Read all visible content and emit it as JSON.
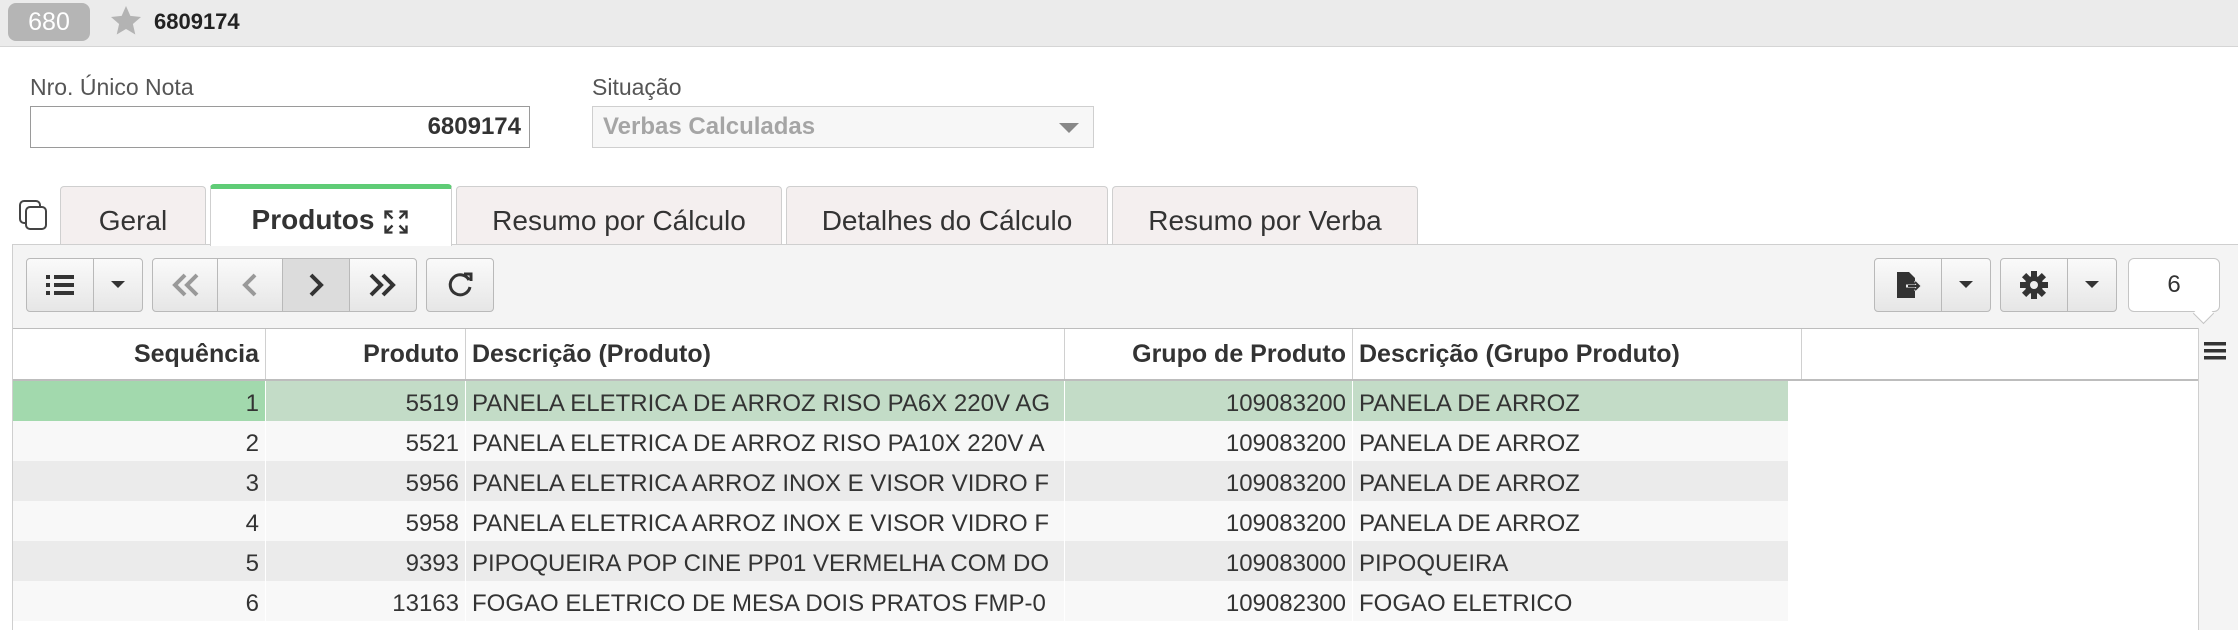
{
  "header": {
    "record_badge": "680",
    "record_id": "6809174"
  },
  "form": {
    "nro_label": "Nro. Único Nota",
    "nro_value": "6809174",
    "situacao_label": "Situação",
    "situacao_value": "Verbas Calculadas"
  },
  "tabs": [
    {
      "label": "Geral"
    },
    {
      "label": "Produtos"
    },
    {
      "label": "Resumo por Cálculo"
    },
    {
      "label": "Detalhes do Cálculo"
    },
    {
      "label": "Resumo por Verba"
    }
  ],
  "toolbar": {
    "record_count": "6"
  },
  "table": {
    "columns": [
      "Sequência",
      "Produto",
      "Descrição (Produto)",
      "Grupo de Produto",
      "Descrição (Grupo Produto)"
    ],
    "rows": [
      {
        "seq": "1",
        "produto": "5519",
        "descricao": "PANELA ELETRICA DE ARROZ RISO PA6X 220V AG",
        "grupo": "109083200",
        "grupo_desc": "PANELA DE ARROZ"
      },
      {
        "seq": "2",
        "produto": "5521",
        "descricao": "PANELA ELETRICA DE ARROZ RISO PA10X 220V A",
        "grupo": "109083200",
        "grupo_desc": "PANELA DE ARROZ"
      },
      {
        "seq": "3",
        "produto": "5956",
        "descricao": "PANELA ELETRICA ARROZ INOX E VISOR VIDRO F",
        "grupo": "109083200",
        "grupo_desc": "PANELA DE ARROZ"
      },
      {
        "seq": "4",
        "produto": "5958",
        "descricao": "PANELA ELETRICA ARROZ INOX E VISOR VIDRO F",
        "grupo": "109083200",
        "grupo_desc": "PANELA DE ARROZ"
      },
      {
        "seq": "5",
        "produto": "9393",
        "descricao": "PIPOQUEIRA POP CINE PP01 VERMELHA COM DO",
        "grupo": "109083000",
        "grupo_desc": "PIPOQUEIRA"
      },
      {
        "seq": "6",
        "produto": "13163",
        "descricao": "FOGAO ELETRICO DE MESA DOIS PRATOS FMP-0",
        "grupo": "109082300",
        "grupo_desc": "FOGAO ELETRICO"
      }
    ]
  },
  "colors": {
    "accent": "#5fcc76",
    "selected_row": "#c3dcc7"
  }
}
